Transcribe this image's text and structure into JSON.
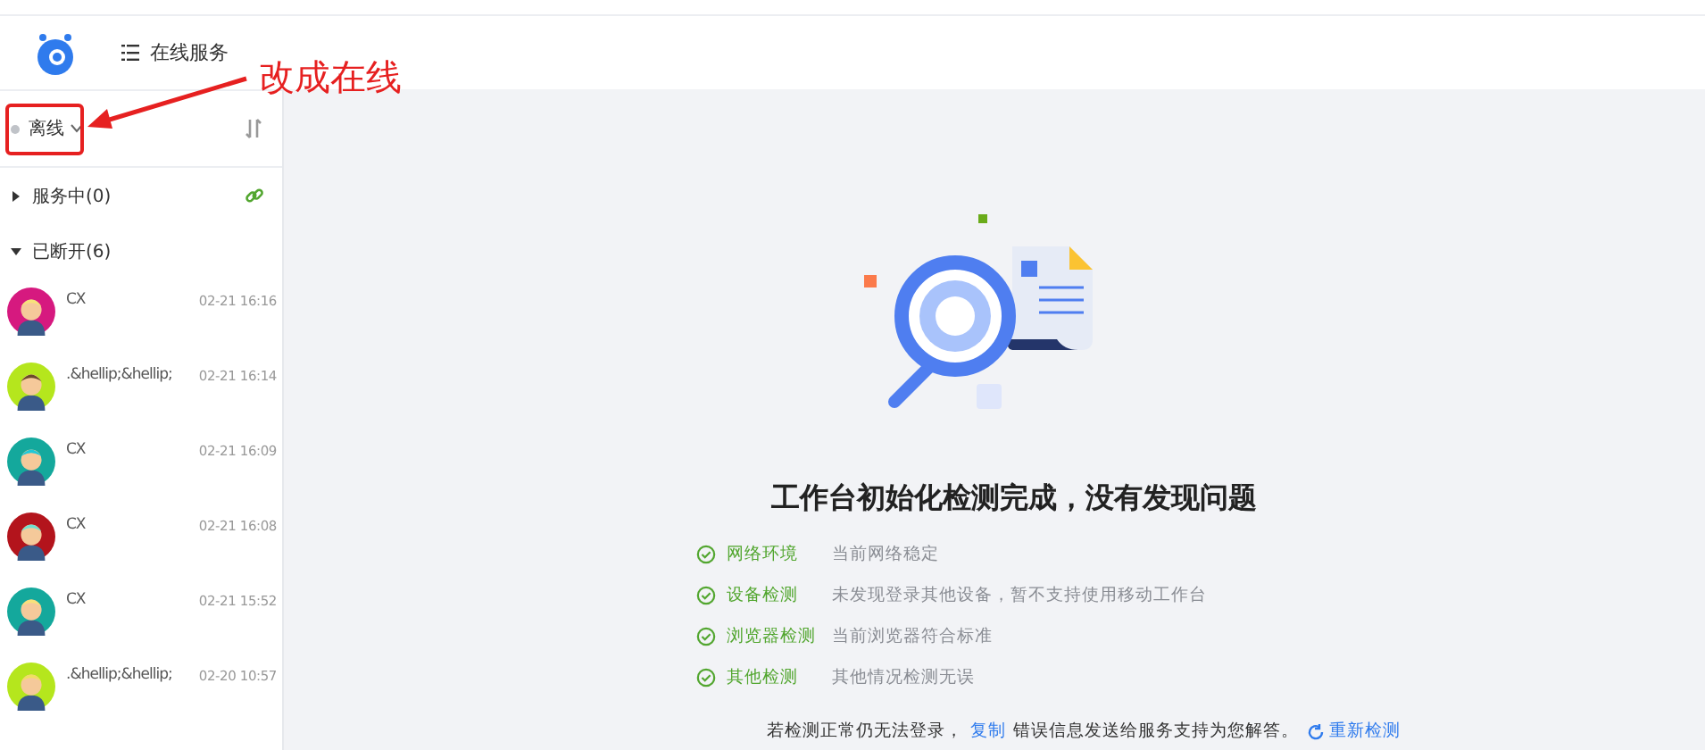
{
  "header": {
    "menu_label": "在线服务"
  },
  "status": {
    "label": "离线",
    "online": false
  },
  "groups": [
    {
      "label": "服务中(0)",
      "expanded": false
    },
    {
      "label": "已断开(6)",
      "expanded": true
    }
  ],
  "conversations": [
    {
      "name": "CX",
      "time": "02-21 16:16",
      "color": "#d6197f"
    },
    {
      "name": ".&hellip;&hellip;",
      "time": "02-21 16:14",
      "color": "#b5e61d"
    },
    {
      "name": "CX",
      "time": "02-21 16:09",
      "color": "#14a89c"
    },
    {
      "name": "CX",
      "time": "02-21 16:08",
      "color": "#b3141c"
    },
    {
      "name": "CX",
      "time": "02-21 15:52",
      "color": "#14a89c"
    },
    {
      "name": ".&hellip;&hellip;",
      "time": "02-20 10:57",
      "color": "#b5e61d"
    }
  ],
  "result": {
    "title": "工作台初始化检测完成，没有发现问题",
    "checks": [
      {
        "name": "网络环境",
        "detail": "当前网络稳定",
        "passed": true
      },
      {
        "name": "设备检测",
        "detail": "未发现登录其他设备，暂不支持使用移动工作台",
        "passed": true
      },
      {
        "name": "浏览器检测",
        "detail": "当前浏览器符合标准",
        "passed": true
      },
      {
        "name": "其他检测",
        "detail": "其他情况检测无误",
        "passed": true
      }
    ],
    "footer_before": "若检测正常仍无法登录，",
    "copy_link": "复制",
    "footer_after": "错误信息发送给服务支持为您解答。",
    "retry_link": "重新检测"
  },
  "annotation": {
    "text": "改成在线"
  }
}
